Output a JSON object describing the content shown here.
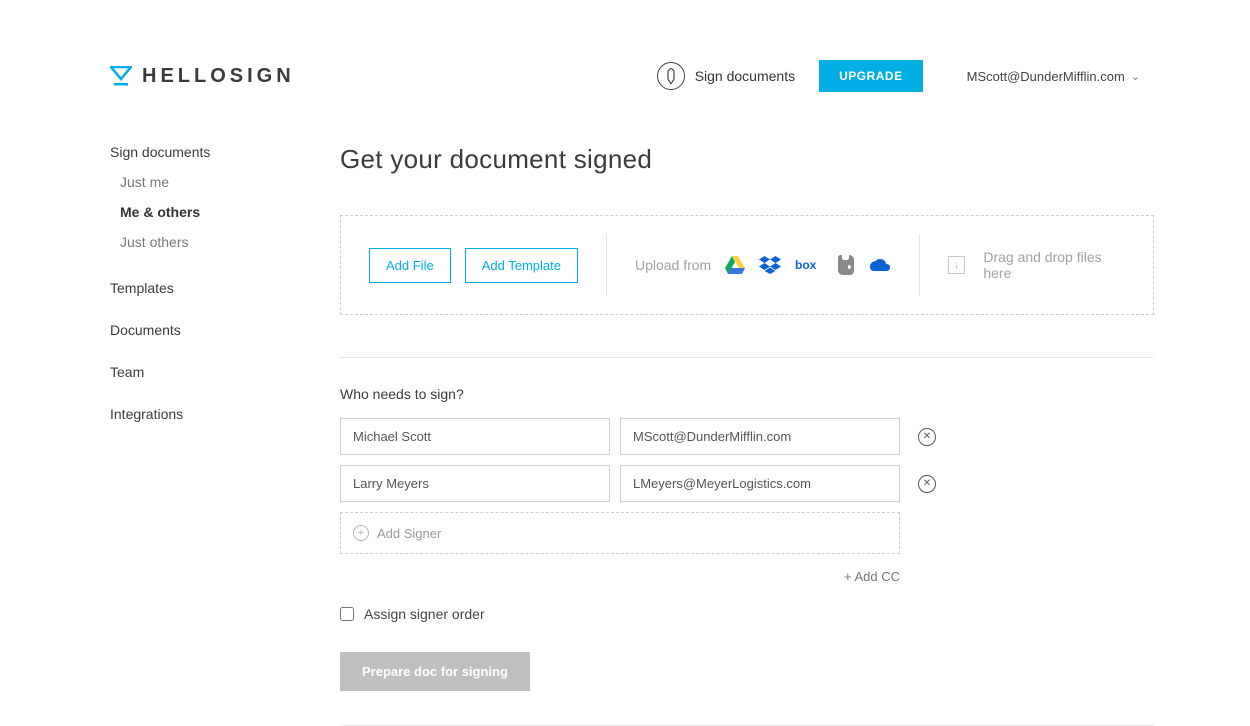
{
  "header": {
    "brand": "HELLOSIGN",
    "sign_documents": "Sign documents",
    "upgrade": "UPGRADE",
    "user_email": "MScott@DunderMifflin.com"
  },
  "sidebar": {
    "sign_documents": "Sign documents",
    "sub": {
      "just_me": "Just me",
      "me_others": "Me & others",
      "just_others": "Just others"
    },
    "templates": "Templates",
    "documents": "Documents",
    "team": "Team",
    "integrations": "Integrations"
  },
  "main": {
    "title": "Get your document signed",
    "upload": {
      "add_file": "Add File",
      "add_template": "Add Template",
      "upload_from": "Upload from",
      "dnd": "Drag and drop files here"
    },
    "who_label": "Who needs to sign?",
    "signers": [
      {
        "name": "Michael Scott",
        "email": "MScott@DunderMifflin.com"
      },
      {
        "name": "Larry Meyers",
        "email": "LMeyers@MeyerLogistics.com"
      }
    ],
    "add_signer": "Add Signer",
    "add_cc": "+ Add CC",
    "assign_order": "Assign signer order",
    "prepare": "Prepare doc for signing"
  }
}
